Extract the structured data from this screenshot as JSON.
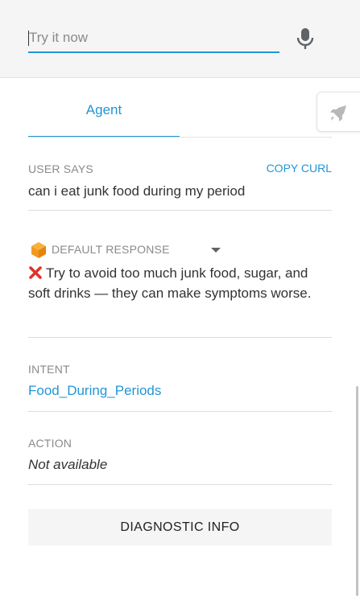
{
  "try_it": {
    "placeholder": "Try it now",
    "value": ""
  },
  "icons": {
    "mic": "microphone-icon",
    "rocket": "rocket-icon",
    "cube": "cube-icon",
    "dropdown": "caret-down-icon",
    "response_mark": "red-x-icon"
  },
  "tabs": [
    {
      "label": "Agent",
      "active": true
    }
  ],
  "user_says": {
    "label": "USER SAYS",
    "copy_curl": "COPY CURL",
    "text": "can i eat junk food during my period"
  },
  "default_response": {
    "label": "DEFAULT RESPONSE",
    "text": "Try to avoid too much junk food, sugar, and soft drinks — they can make symptoms worse."
  },
  "intent": {
    "label": "INTENT",
    "value": "Food_During_Periods"
  },
  "action": {
    "label": "ACTION",
    "value": "Not available"
  },
  "diagnostic_button": {
    "label": "DIAGNOSTIC INFO"
  },
  "colors": {
    "accent": "#2196d6",
    "label_gray": "#8a8a8a",
    "cube_orange": "#f29a1f",
    "error_red": "#e0332c",
    "panel_gray": "#f5f5f5"
  }
}
